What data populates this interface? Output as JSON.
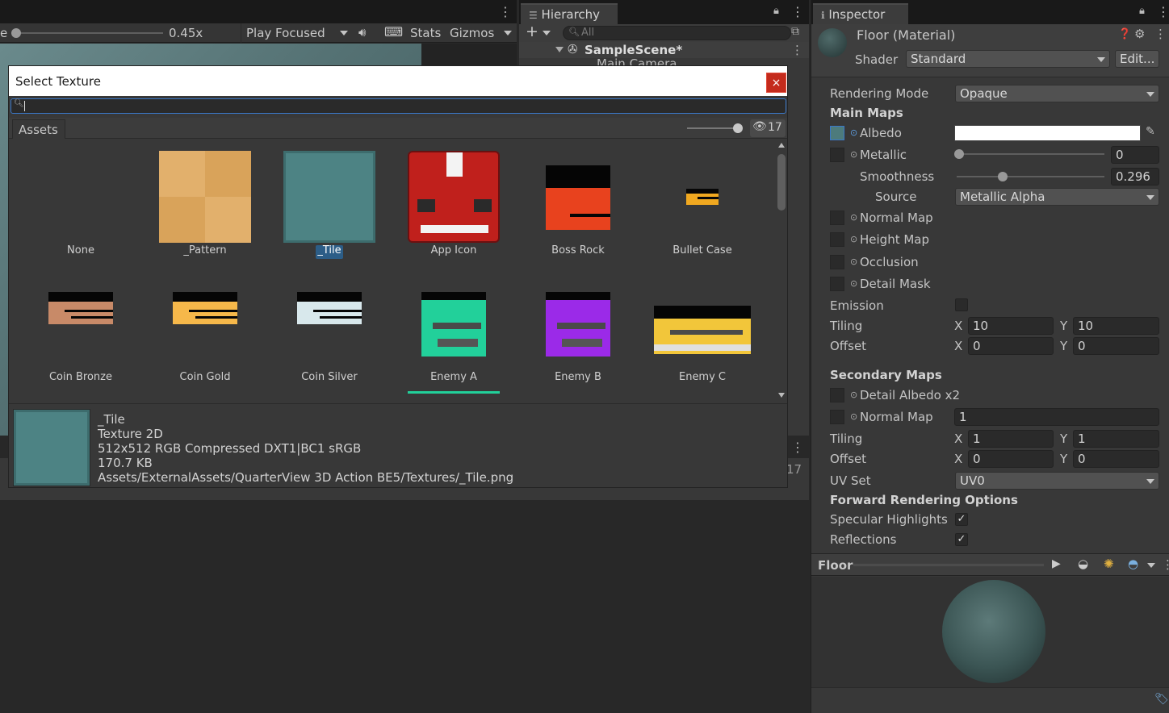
{
  "game_toolbar": {
    "scale_label_partial": "e",
    "scale_value": "0.45x",
    "play_mode": "Play Focused",
    "stats": "Stats",
    "gizmos": "Gizmos"
  },
  "hierarchy": {
    "tab": "Hierarchy",
    "search_placeholder": "All",
    "scene": "SampleScene*",
    "child_partial": "Main Camera"
  },
  "dialog": {
    "title": "Select Texture",
    "close": "×",
    "search_value": "",
    "tab": "Assets",
    "hidden_count": "17",
    "textures": [
      {
        "label": "None"
      },
      {
        "label": "_Pattern"
      },
      {
        "label": "_Tile",
        "selected": true
      },
      {
        "label": "App Icon"
      },
      {
        "label": "Boss Rock"
      },
      {
        "label": "Bullet Case"
      },
      {
        "label": "Coin Bronze"
      },
      {
        "label": "Coin Gold"
      },
      {
        "label": "Coin Silver"
      },
      {
        "label": "Enemy A"
      },
      {
        "label": "Enemy B"
      },
      {
        "label": "Enemy C"
      }
    ],
    "preview": {
      "name": "_Tile",
      "type": "Texture 2D",
      "format": "512x512  RGB Compressed DXT1|BC1 sRGB",
      "size": "170.7 KB",
      "path": "Assets/ExternalAssets/QuarterView 3D Action BE5/Textures/_Tile.png"
    }
  },
  "project_partial_count": "17",
  "inspector": {
    "tab": "Inspector",
    "material_title": "Floor (Material)",
    "shader_label": "Shader",
    "shader_value": "Standard",
    "edit_button": "Edit...",
    "rendering_mode_label": "Rendering Mode",
    "rendering_mode_value": "Opaque",
    "main_maps": "Main Maps",
    "albedo": "Albedo",
    "albedo_color": "#ffffff",
    "metallic": "Metallic",
    "metallic_value": "0",
    "smoothness": "Smoothness",
    "smoothness_value": "0.296",
    "smoothness_fraction": 0.296,
    "source": "Source",
    "source_value": "Metallic Alpha",
    "normal_map": "Normal Map",
    "height_map": "Height Map",
    "occlusion": "Occlusion",
    "detail_mask": "Detail Mask",
    "emission": "Emission",
    "tiling": "Tiling",
    "offset": "Offset",
    "x": "X",
    "y": "Y",
    "main_tiling": {
      "x": "10",
      "y": "10"
    },
    "main_offset": {
      "x": "0",
      "y": "0"
    },
    "secondary_maps": "Secondary Maps",
    "detail_albedo": "Detail Albedo x2",
    "sec_normal_map": "Normal Map",
    "sec_normal_value": "1",
    "sec_tiling": {
      "x": "1",
      "y": "1"
    },
    "sec_offset": {
      "x": "0",
      "y": "0"
    },
    "uv_set": "UV Set",
    "uv_set_value": "UV0",
    "forward_options": "Forward Rendering Options",
    "specular": "Specular Highlights",
    "reflections": "Reflections",
    "preview_title": "Floor"
  },
  "colors": {
    "accent": "#3a78c9",
    "selection": "#2c5d87",
    "close": "#c42b1c",
    "tile": "#4d8384"
  }
}
